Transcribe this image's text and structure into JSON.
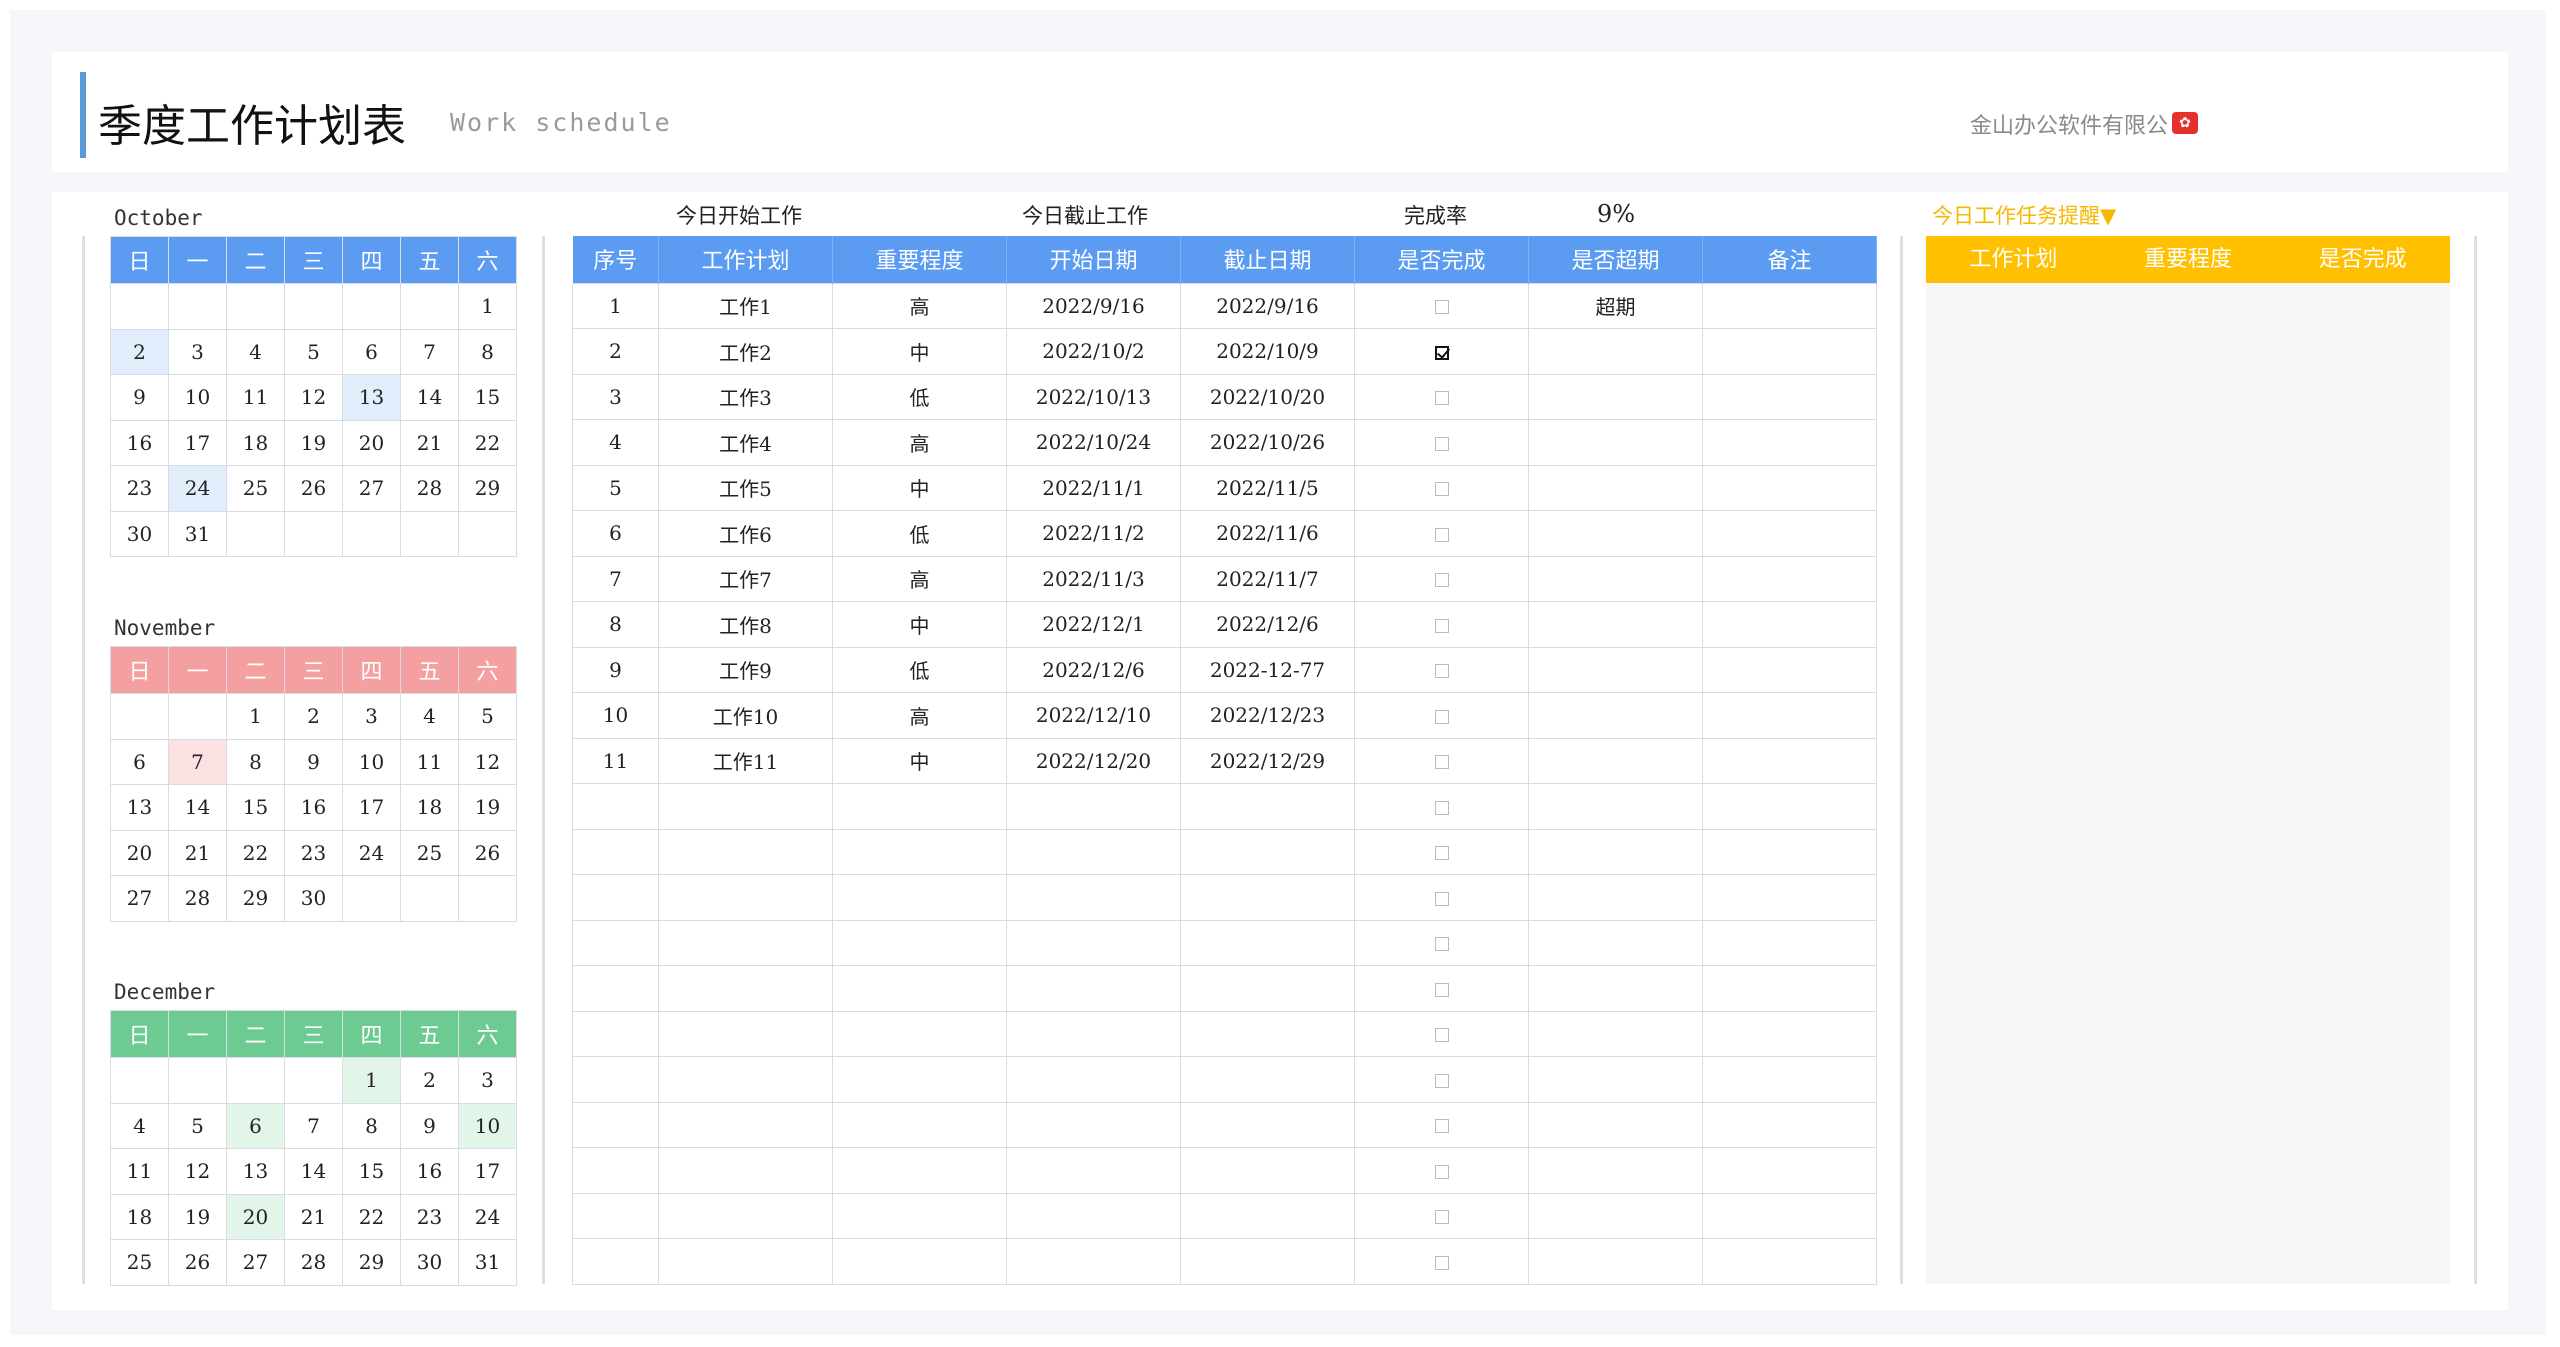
{
  "header": {
    "title": "季度工作计划表",
    "subtitle": "Work schedule",
    "company": "金山办公软件有限公",
    "logo_icon": "wps-logo-icon"
  },
  "weekdays": [
    "日",
    "一",
    "二",
    "三",
    "四",
    "五",
    "六"
  ],
  "calendars": [
    {
      "month": "October",
      "color": "#5b9cf2",
      "weeks": [
        [
          "",
          "",
          "",
          "",
          "",
          "",
          "1"
        ],
        [
          "2",
          "3",
          "4",
          "5",
          "6",
          "7",
          "8"
        ],
        [
          "9",
          "10",
          "11",
          "12",
          "13",
          "14",
          "15"
        ],
        [
          "16",
          "17",
          "18",
          "19",
          "20",
          "21",
          "22"
        ],
        [
          "23",
          "24",
          "25",
          "26",
          "27",
          "28",
          "29"
        ],
        [
          "30",
          "31",
          "",
          "",
          "",
          "",
          ""
        ]
      ],
      "highlighted": [
        "2",
        "13",
        "24"
      ]
    },
    {
      "month": "November",
      "color": "#f5a0a0",
      "weeks": [
        [
          "",
          "",
          "1",
          "2",
          "3",
          "4",
          "5"
        ],
        [
          "6",
          "7",
          "8",
          "9",
          "10",
          "11",
          "12"
        ],
        [
          "13",
          "14",
          "15",
          "16",
          "17",
          "18",
          "19"
        ],
        [
          "20",
          "21",
          "22",
          "23",
          "24",
          "25",
          "26"
        ],
        [
          "27",
          "28",
          "29",
          "30",
          "",
          "",
          ""
        ]
      ],
      "highlighted": [
        "7"
      ]
    },
    {
      "month": "December",
      "color": "#6dcb92",
      "weeks": [
        [
          "",
          "",
          "",
          "",
          "1",
          "2",
          "3"
        ],
        [
          "4",
          "5",
          "6",
          "7",
          "8",
          "9",
          "10"
        ],
        [
          "11",
          "12",
          "13",
          "14",
          "15",
          "16",
          "17"
        ],
        [
          "18",
          "19",
          "20",
          "21",
          "22",
          "23",
          "24"
        ],
        [
          "25",
          "26",
          "27",
          "28",
          "29",
          "30",
          "31"
        ]
      ],
      "highlighted": [
        "1",
        "6",
        "10",
        "20"
      ]
    }
  ],
  "summary": {
    "today_start_label": "今日开始工作",
    "today_end_label": "今日截止工作",
    "completion_label": "完成率",
    "completion_value": "9%"
  },
  "tasks": {
    "columns": [
      "序号",
      "工作计划",
      "重要程度",
      "开始日期",
      "截止日期",
      "是否完成",
      "是否超期",
      "备注"
    ],
    "rows": [
      {
        "no": "1",
        "plan": "工作1",
        "priority": "高",
        "start": "2022/9/16",
        "end": "2022/9/16",
        "done": false,
        "overdue": "超期",
        "note": ""
      },
      {
        "no": "2",
        "plan": "工作2",
        "priority": "中",
        "start": "2022/10/2",
        "end": "2022/10/9",
        "done": true,
        "overdue": "",
        "note": ""
      },
      {
        "no": "3",
        "plan": "工作3",
        "priority": "低",
        "start": "2022/10/13",
        "end": "2022/10/20",
        "done": false,
        "overdue": "",
        "note": ""
      },
      {
        "no": "4",
        "plan": "工作4",
        "priority": "高",
        "start": "2022/10/24",
        "end": "2022/10/26",
        "done": false,
        "overdue": "",
        "note": ""
      },
      {
        "no": "5",
        "plan": "工作5",
        "priority": "中",
        "start": "2022/11/1",
        "end": "2022/11/5",
        "done": false,
        "overdue": "",
        "note": ""
      },
      {
        "no": "6",
        "plan": "工作6",
        "priority": "低",
        "start": "2022/11/2",
        "end": "2022/11/6",
        "done": false,
        "overdue": "",
        "note": ""
      },
      {
        "no": "7",
        "plan": "工作7",
        "priority": "高",
        "start": "2022/11/3",
        "end": "2022/11/7",
        "done": false,
        "overdue": "",
        "note": ""
      },
      {
        "no": "8",
        "plan": "工作8",
        "priority": "中",
        "start": "2022/12/1",
        "end": "2022/12/6",
        "done": false,
        "overdue": "",
        "note": ""
      },
      {
        "no": "9",
        "plan": "工作9",
        "priority": "低",
        "start": "2022/12/6",
        "end": "2022-12-77",
        "done": false,
        "overdue": "",
        "note": ""
      },
      {
        "no": "10",
        "plan": "工作10",
        "priority": "高",
        "start": "2022/12/10",
        "end": "2022/12/23",
        "done": false,
        "overdue": "",
        "note": ""
      },
      {
        "no": "11",
        "plan": "工作11",
        "priority": "中",
        "start": "2022/12/20",
        "end": "2022/12/29",
        "done": false,
        "overdue": "",
        "note": ""
      }
    ],
    "empty_rows": 11
  },
  "reminder": {
    "title": "今日工作任务提醒▼",
    "columns": [
      "工作计划",
      "重要程度",
      "是否完成"
    ],
    "accent": "#ffc000"
  }
}
